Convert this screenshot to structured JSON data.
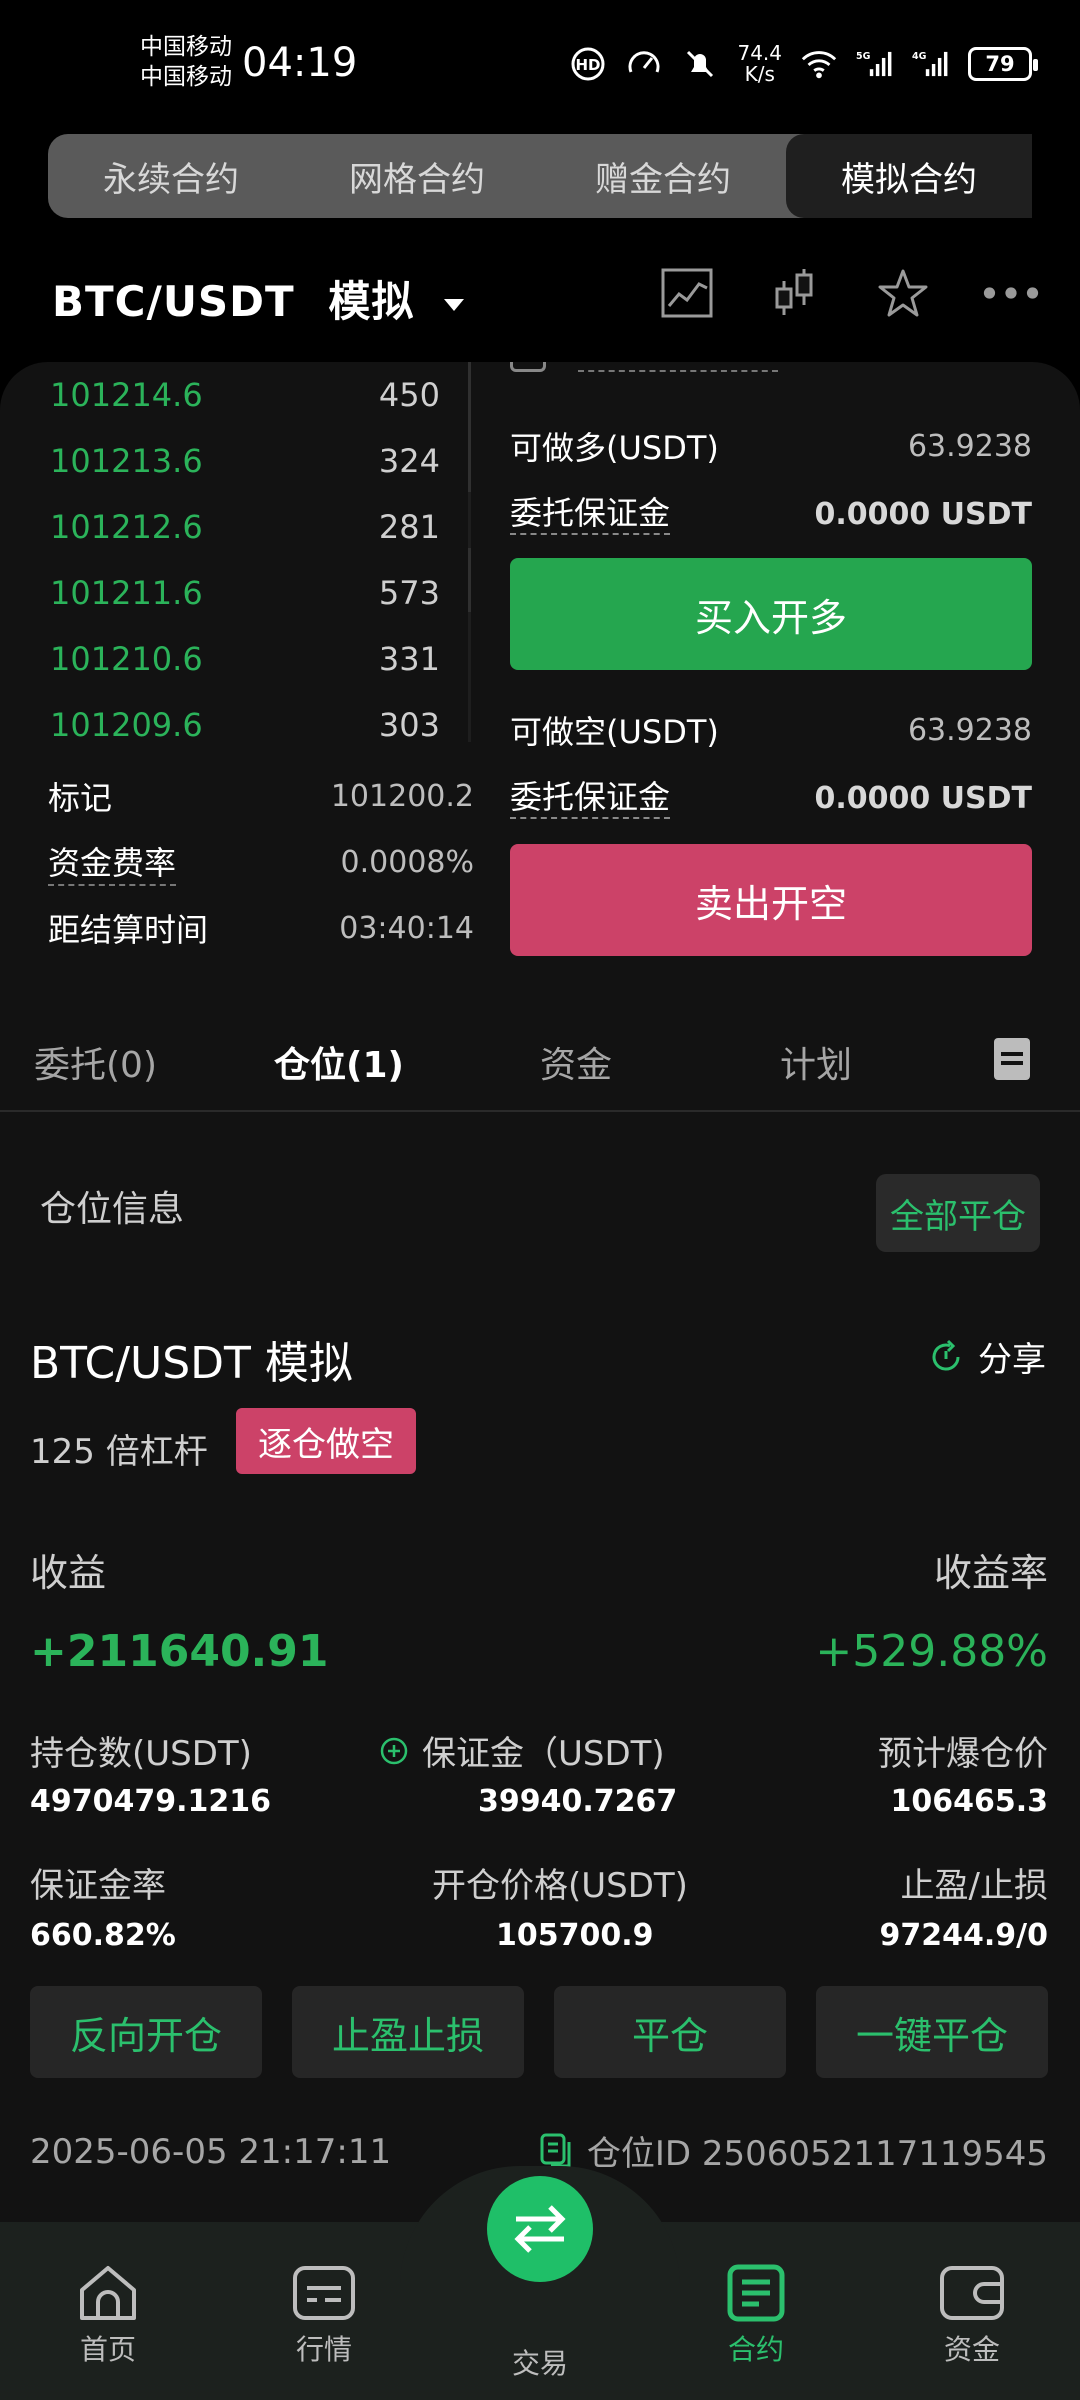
{
  "status_bar": {
    "carrier_1": "中国移动",
    "carrier_2": "中国移动",
    "time": "04:19",
    "net_speed_value": "74.4",
    "net_speed_unit": "K/s",
    "signal_1": "5G",
    "signal_2": "4G",
    "battery": "79"
  },
  "top_tabs": [
    {
      "label": "永续合约",
      "active": false
    },
    {
      "label": "网格合约",
      "active": false
    },
    {
      "label": "赠金合约",
      "active": false
    },
    {
      "label": "模拟合约",
      "active": true
    }
  ],
  "header": {
    "pair": "BTC/USDT",
    "mode": "模拟",
    "icons": [
      "chart-icon",
      "candlestick-icon",
      "star-icon",
      "more-icon"
    ]
  },
  "order_book": [
    {
      "price": "101214.6",
      "qty": "450"
    },
    {
      "price": "101213.6",
      "qty": "324"
    },
    {
      "price": "101212.6",
      "qty": "281"
    },
    {
      "price": "101211.6",
      "qty": "573"
    },
    {
      "price": "101210.6",
      "qty": "331"
    },
    {
      "price": "101209.6",
      "qty": "303"
    }
  ],
  "market_info": {
    "mark_label": "标记",
    "mark_value": "101200.2",
    "funding_label": "资金费率",
    "funding_value": "0.0008%",
    "settle_label": "距结算时间",
    "settle_value": "03:40:14"
  },
  "trade": {
    "long_label": "可做多(USDT)",
    "long_value": "63.9238",
    "margin_label": "委托保证金",
    "long_margin_value": "0.0000 USDT",
    "buy_button": "买入开多",
    "short_label": "可做空(USDT)",
    "short_value": "63.9238",
    "short_margin_value": "0.0000 USDT",
    "sell_button": "卖出开空"
  },
  "lower_tabs": [
    {
      "label": "委托(0)",
      "active": false
    },
    {
      "label": "仓位(1)",
      "active": true
    },
    {
      "label": "资金",
      "active": false
    },
    {
      "label": "计划",
      "active": false
    }
  ],
  "position": {
    "section_title": "仓位信息",
    "close_all": "全部平仓",
    "pair": "BTC/USDT 模拟",
    "share": "分享",
    "leverage": "125 倍杠杆",
    "side": "逐仓做空",
    "pnl_label": "收益",
    "pnl_rate_label": "收益率",
    "pnl_value": "+211640.91",
    "pnl_rate_value": "+529.88%",
    "size_label": "持仓数(USDT)",
    "size_value": "4970479.1216",
    "margin_label": "保证金（USDT)",
    "margin_value": "39940.7267",
    "liq_label": "预计爆仓价",
    "liq_value": "106465.3",
    "margin_rate_label": "保证金率",
    "margin_rate_value": "660.82%",
    "entry_label": "开仓价格(USDT)",
    "entry_value": "105700.9",
    "tpsl_label": "止盈/止损",
    "tpsl_value": "97244.9/0",
    "actions": [
      "反向开仓",
      "止盈止损",
      "平仓",
      "一键平仓"
    ],
    "time": "2025-06-05 21:17:11",
    "id_label": "仓位ID 2506052117119545"
  },
  "bottom_nav": {
    "home": "首页",
    "market": "行情",
    "trade": "交易",
    "contract": "合约",
    "assets": "资金"
  },
  "colors": {
    "green": "#2bb35a",
    "red": "#cc4268",
    "accent": "#1fbf68"
  }
}
